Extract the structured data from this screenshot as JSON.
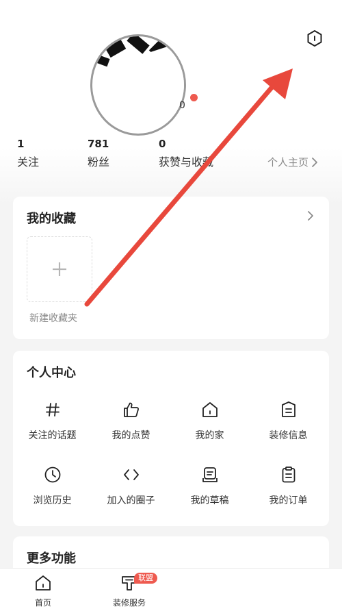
{
  "profile": {
    "avatar_number": "0",
    "stats": [
      {
        "value": "1",
        "label": "关注"
      },
      {
        "value": "781",
        "label": "粉丝"
      },
      {
        "value": "0",
        "label": "获赞与收藏"
      }
    ],
    "homepage_link": "个人主页"
  },
  "favorites": {
    "title": "我的收藏",
    "new_folder_label": "新建收藏夹"
  },
  "personal_center": {
    "title": "个人中心",
    "items": [
      {
        "icon": "hash-icon",
        "label": "关注的话题"
      },
      {
        "icon": "thumbs-up-icon",
        "label": "我的点赞"
      },
      {
        "icon": "home-icon",
        "label": "我的家"
      },
      {
        "icon": "document-icon",
        "label": "装修信息"
      },
      {
        "icon": "clock-icon",
        "label": "浏览历史"
      },
      {
        "icon": "code-icon",
        "label": "加入的圈子"
      },
      {
        "icon": "draft-icon",
        "label": "我的草稿"
      },
      {
        "icon": "clipboard-icon",
        "label": "我的订单"
      }
    ]
  },
  "more": {
    "title": "更多功能"
  },
  "tabbar": {
    "items": [
      {
        "icon": "home-icon",
        "label": "首页"
      },
      {
        "icon": "service-icon",
        "label": "装修服务",
        "badge": "联盟"
      }
    ]
  },
  "colors": {
    "annotation_arrow": "#e8483c",
    "badge": "#ee5a4f",
    "background": "#f4f4f4"
  }
}
